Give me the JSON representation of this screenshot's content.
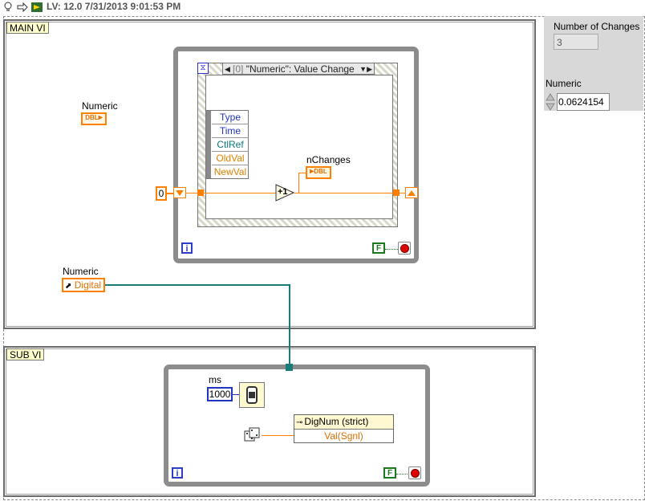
{
  "toolbar": {
    "version_text": "LV: 12.0 7/31/2013 9:01:53 PM",
    "icons": [
      "lightbulb-icon",
      "step-icon",
      "highlight-icon"
    ]
  },
  "main_vi": {
    "frame_label": "MAIN VI",
    "numeric_label": "Numeric",
    "numeric_terminal": "DBL",
    "numeric_digital_label": "Numeric",
    "numeric_digital_text": "Digital",
    "shift_register_init": "0",
    "event_case": {
      "index": "[0]",
      "name": "\"Numeric\": Value Change"
    },
    "event_data_rows": [
      "Type",
      "Time",
      "CtlRef",
      "OldVal",
      "NewVal"
    ],
    "increment_label": "+1",
    "nchanges_label": "nChanges",
    "nchanges_terminal": "DBL",
    "iteration_label": "i",
    "stop_const": "F"
  },
  "sub_vi": {
    "frame_label": "SUB VI",
    "ms_label": "ms",
    "ms_value": "1000",
    "property_node_name": "DigNum (strict)",
    "property_node_value": "Val(Sgnl)",
    "iteration_label": "i",
    "stop_const": "F"
  },
  "front_panel": {
    "number_of_changes_label": "Number of Changes",
    "number_of_changes_value": "3",
    "numeric_label": "Numeric",
    "numeric_value": "0.0624154"
  },
  "colors": {
    "orange_wire": "#ff7f00",
    "teal_wire": "#1a7b7b",
    "frame_label_bg": "#ffffcc"
  }
}
